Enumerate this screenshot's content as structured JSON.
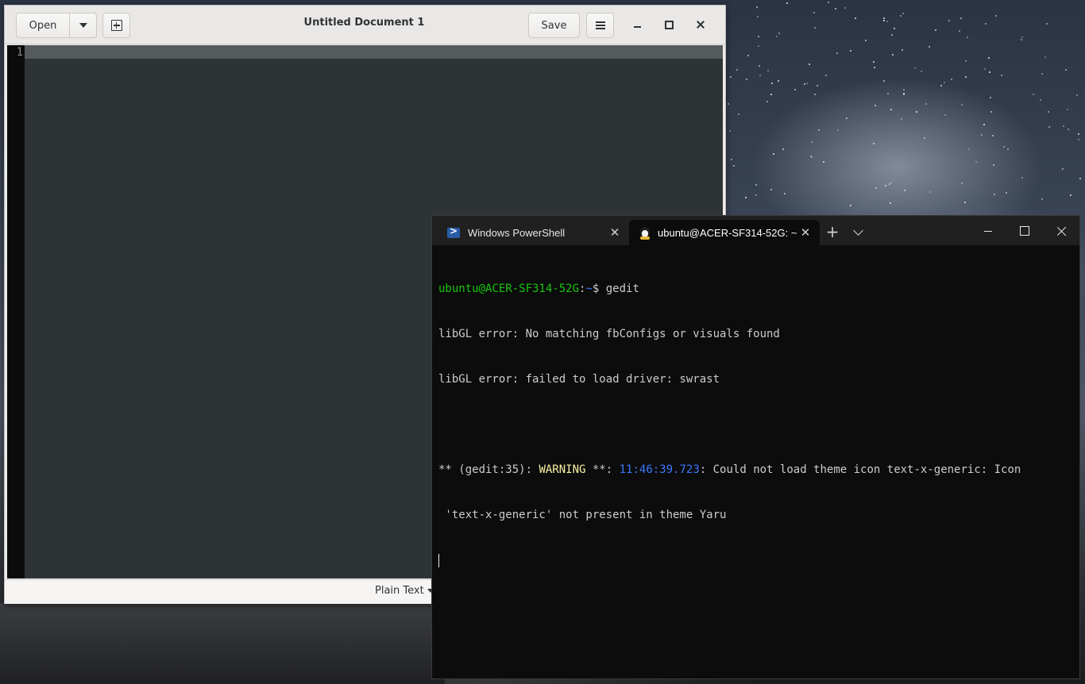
{
  "colors": {
    "gedit_editor_bg": "#2e3436",
    "gedit_gutter_bg": "#0b0b0b",
    "terminal_bg": "#0c0c0c",
    "terminal_prompt_user": "#16c60c",
    "terminal_prompt_path": "#3b78ff",
    "terminal_warning": "#f9f1a5"
  },
  "gedit": {
    "title": "Untitled Document 1",
    "open_label": "Open",
    "save_label": "Save",
    "line_number": "1",
    "language": "Plain Text",
    "icons": {
      "open_menu": "chevron-down-icon",
      "new_document": "new-document-icon",
      "menu": "hamburger-menu-icon",
      "minimize": "minimize-icon",
      "maximize": "maximize-icon",
      "close": "close-icon"
    }
  },
  "terminal": {
    "tabs": [
      {
        "label": "Windows PowerShell",
        "icon": "powershell-icon",
        "active": false
      },
      {
        "label": "ubuntu@ACER-SF314-52G: ~",
        "icon": "linux-tux-icon",
        "active": true
      }
    ],
    "prompt_user": "ubuntu@ACER-SF314-52G",
    "prompt_sep": ":",
    "prompt_path": "~",
    "prompt_symbol": "$ ",
    "command": "gedit",
    "line2": "libGL error: No matching fbConfigs or visuals found",
    "line3": "libGL error: failed to load driver: swrast",
    "warning_prefix": "** (gedit:35): ",
    "warning_word": "WARNING",
    "warning_suffix": " **: ",
    "warning_time": "11:46:39.723",
    "warning_message": ": Could not load theme icon text-x-generic: Icon",
    "warning_message_cont": " 'text-x-generic' not present in theme Yaru"
  }
}
